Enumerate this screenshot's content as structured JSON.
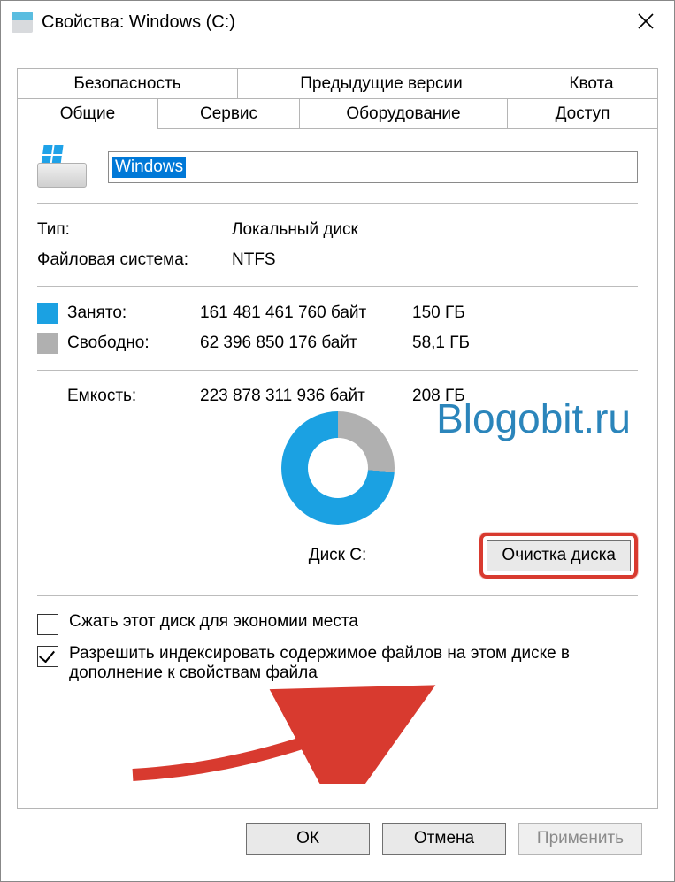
{
  "title": "Свойства: Windows (C:)",
  "tabs": {
    "top": [
      "Безопасность",
      "Предыдущие версии",
      "Квота"
    ],
    "bottom": [
      "Общие",
      "Сервис",
      "Оборудование",
      "Доступ"
    ],
    "active": "Общие"
  },
  "general": {
    "label_value": "Windows",
    "type_label": "Тип:",
    "type_value": "Локальный диск",
    "fs_label": "Файловая система:",
    "fs_value": "NTFS",
    "used_label": "Занято:",
    "used_bytes": "161 481 461 760 байт",
    "used_gb": "150 ГБ",
    "free_label": "Свободно:",
    "free_bytes": "62 396 850 176 байт",
    "free_gb": "58,1 ГБ",
    "capacity_label": "Емкость:",
    "capacity_bytes": "223 878 311 936 байт",
    "capacity_gb": "208 ГБ",
    "disk_caption": "Диск C:",
    "cleanup_button": "Очистка диска",
    "compress_label": "Сжать этот диск для экономии места",
    "index_label": "Разрешить индексировать содержимое файлов на этом диске в дополнение к свойствам файла",
    "compress_checked": false,
    "index_checked": true
  },
  "chart_data": {
    "type": "pie",
    "title": "Диск C:",
    "series": [
      {
        "name": "Занято",
        "value": 150,
        "unit": "ГБ",
        "bytes": 161481461760,
        "color": "#1ba1e2"
      },
      {
        "name": "Свободно",
        "value": 58.1,
        "unit": "ГБ",
        "bytes": 62396850176,
        "color": "#b0b0b0"
      }
    ],
    "total": {
      "value": 208,
      "unit": "ГБ",
      "bytes": 223878311936
    }
  },
  "buttons": {
    "ok": "ОК",
    "cancel": "Отмена",
    "apply": "Применить"
  },
  "watermark": "Blogobit.ru"
}
